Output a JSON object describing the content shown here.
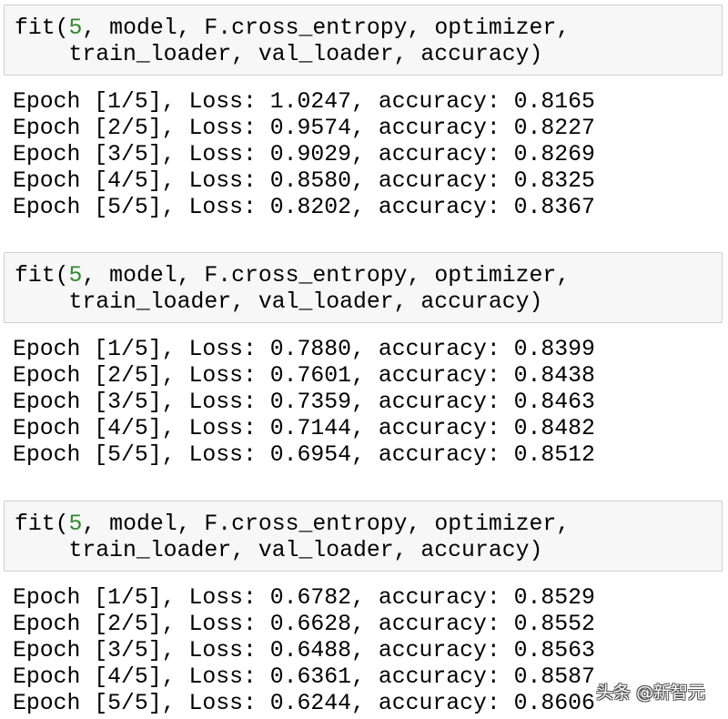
{
  "cells": [
    {
      "code": {
        "line1_prefix": "fit(",
        "line1_number": "5",
        "line1_suffix": ", model, F.cross_entropy, optimizer,",
        "line2": "    train_loader, val_loader, accuracy)"
      },
      "output": [
        {
          "epoch": "1/5",
          "loss": "1.0247",
          "accuracy": "0.8165"
        },
        {
          "epoch": "2/5",
          "loss": "0.9574",
          "accuracy": "0.8227"
        },
        {
          "epoch": "3/5",
          "loss": "0.9029",
          "accuracy": "0.8269"
        },
        {
          "epoch": "4/5",
          "loss": "0.8580",
          "accuracy": "0.8325"
        },
        {
          "epoch": "5/5",
          "loss": "0.8202",
          "accuracy": "0.8367"
        }
      ]
    },
    {
      "code": {
        "line1_prefix": "fit(",
        "line1_number": "5",
        "line1_suffix": ", model, F.cross_entropy, optimizer,",
        "line2": "    train_loader, val_loader, accuracy)"
      },
      "output": [
        {
          "epoch": "1/5",
          "loss": "0.7880",
          "accuracy": "0.8399"
        },
        {
          "epoch": "2/5",
          "loss": "0.7601",
          "accuracy": "0.8438"
        },
        {
          "epoch": "3/5",
          "loss": "0.7359",
          "accuracy": "0.8463"
        },
        {
          "epoch": "4/5",
          "loss": "0.7144",
          "accuracy": "0.8482"
        },
        {
          "epoch": "5/5",
          "loss": "0.6954",
          "accuracy": "0.8512"
        }
      ]
    },
    {
      "code": {
        "line1_prefix": "fit(",
        "line1_number": "5",
        "line1_suffix": ", model, F.cross_entropy, optimizer,",
        "line2": "    train_loader, val_loader, accuracy)"
      },
      "output": [
        {
          "epoch": "1/5",
          "loss": "0.6782",
          "accuracy": "0.8529"
        },
        {
          "epoch": "2/5",
          "loss": "0.6628",
          "accuracy": "0.8552"
        },
        {
          "epoch": "3/5",
          "loss": "0.6488",
          "accuracy": "0.8563"
        },
        {
          "epoch": "4/5",
          "loss": "0.6361",
          "accuracy": "0.8587"
        },
        {
          "epoch": "5/5",
          "loss": "0.6244",
          "accuracy": "0.8606"
        }
      ]
    }
  ],
  "output_format": {
    "epoch_prefix": "Epoch [",
    "loss_prefix": "], Loss: ",
    "accuracy_prefix": ", accuracy: "
  },
  "colors": {
    "number_literal": "#2e8b2e",
    "cell_background": "#f7f7f7",
    "cell_border": "#cfcfcf"
  },
  "watermark": "头条 @新智元"
}
